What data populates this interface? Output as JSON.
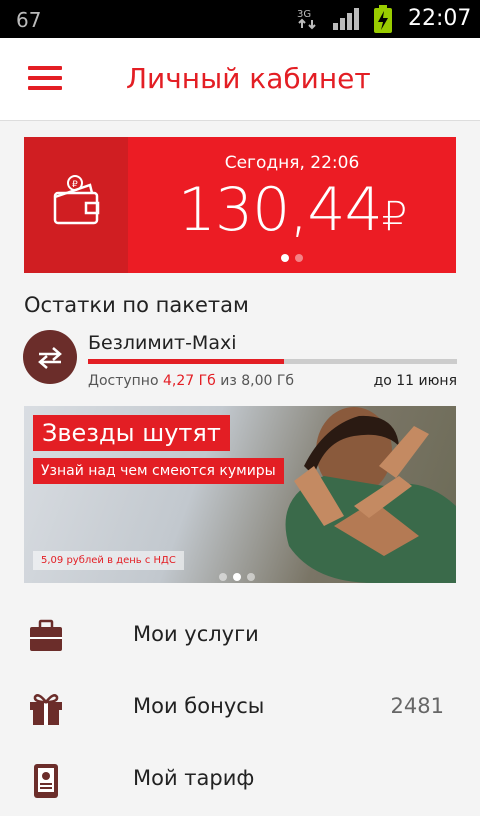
{
  "status_bar": {
    "left_number": "67",
    "network": "3G",
    "time": "22:07"
  },
  "header": {
    "title": "Личный кабинет"
  },
  "balance": {
    "date": "Сегодня, 22:06",
    "amount": "130,44",
    "currency": "₽",
    "page_count": 2,
    "active_page": 0
  },
  "packages": {
    "section_title": "Остатки по пакетам",
    "item": {
      "name": "Безлимит-Maxi",
      "available_label": "Доступно",
      "available_value": "4,27 Гб",
      "of_label": "из",
      "total_value": "8,00 Гб",
      "until": "до 11 июня",
      "used_fraction": 0.53
    }
  },
  "banner": {
    "headline": "Звезды шутят",
    "subheadline": "Узнай над чем смеются кумиры",
    "price_note": "5,09 рублей в день с НДС",
    "page_count": 3,
    "active_page": 1
  },
  "menu": [
    {
      "label": "Мои услуги",
      "icon": "briefcase-icon",
      "badge": ""
    },
    {
      "label": "Мои бонусы",
      "icon": "gift-icon",
      "badge": "2481"
    },
    {
      "label": "Мой тариф",
      "icon": "tariff-icon",
      "badge": ""
    }
  ],
  "colors": {
    "accent": "#e31e24",
    "accent_dark": "#d01e22",
    "icon": "#6b2d2a"
  }
}
